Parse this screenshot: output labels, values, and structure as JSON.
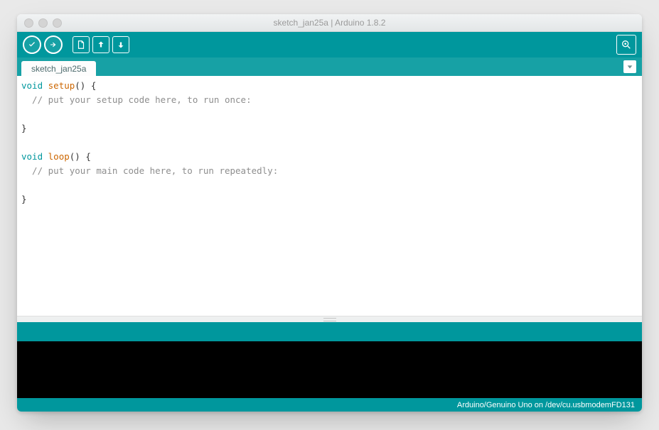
{
  "window": {
    "title": "sketch_jan25a | Arduino 1.8.2"
  },
  "tab": {
    "name": "sketch_jan25a"
  },
  "code": {
    "l1_kw": "void",
    "l1_fn": "setup",
    "l1_rest": "() {",
    "l2": "  // put your setup code here, to run once:",
    "l3": "",
    "l4": "}",
    "l5": "",
    "l6_kw": "void",
    "l6_fn": "loop",
    "l6_rest": "() {",
    "l7": "  // put your main code here, to run repeatedly:",
    "l8": "",
    "l9": "}"
  },
  "footer": {
    "board_port": "Arduino/Genuino Uno on /dev/cu.usbmodemFD131"
  },
  "toolbar": {
    "verify": "Verify",
    "upload": "Upload",
    "new": "New",
    "open": "Open",
    "save": "Save",
    "serial_monitor": "Serial Monitor"
  }
}
